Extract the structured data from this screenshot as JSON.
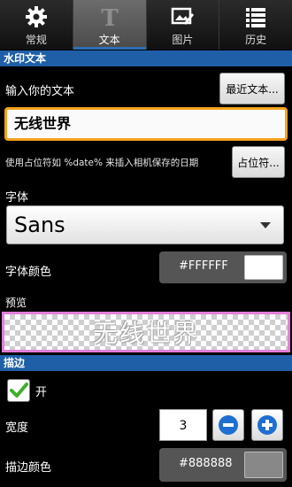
{
  "tabs": [
    {
      "label": "常规",
      "icon": "gear-icon"
    },
    {
      "label": "文本",
      "icon": "text-t-icon",
      "active": true
    },
    {
      "label": "图片",
      "icon": "image-edit-icon"
    },
    {
      "label": "历史",
      "icon": "list-icon"
    }
  ],
  "watermark_section": {
    "title": "水印文本",
    "input_label": "输入你的文本",
    "recent_button": "最近文本...",
    "text_value": "无线世界",
    "hint": "使用占位符如 %date% 来插入相机保存的日期",
    "placeholder_button": "占位符...",
    "font_label": "字体",
    "font_value": "Sans",
    "font_color_label": "字体颜色",
    "font_color_hex": "#FFFFFF",
    "preview_label": "预览",
    "preview_text": "无线世界"
  },
  "stroke_section": {
    "title": "描边",
    "enabled_label": "开",
    "enabled": true,
    "width_label": "宽度",
    "width_value": "3",
    "stroke_color_label": "描边颜色",
    "stroke_color_hex": "#888888"
  },
  "colors": {
    "accent_blue": "#1f5fa8",
    "input_focus_orange": "#f5a21e",
    "preview_border": "#e27fd8"
  }
}
